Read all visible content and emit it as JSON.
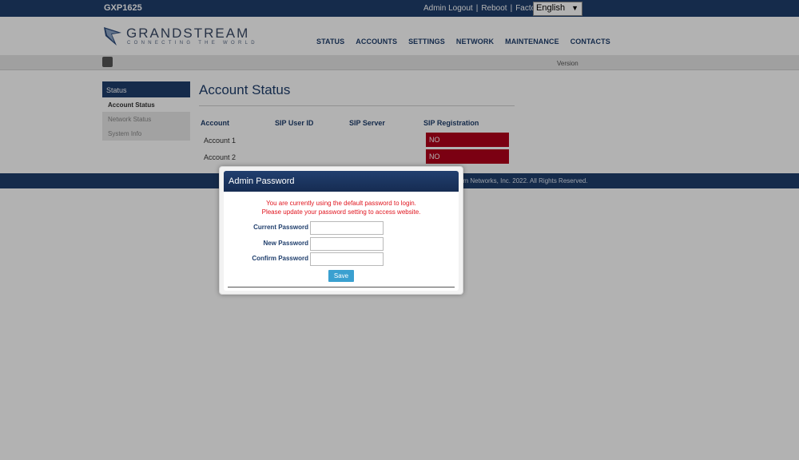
{
  "topbar": {
    "model": "GXP1625",
    "links": [
      "Admin Logout",
      "Reboot",
      "Factory Reset"
    ],
    "separator": "|",
    "language": "English"
  },
  "header": {
    "logo_word": "GRANDSTREAM",
    "logo_tagline": "CONNECTING THE WORLD",
    "nav": [
      "STATUS",
      "ACCOUNTS",
      "SETTINGS",
      "NETWORK",
      "MAINTENANCE",
      "CONTACTS"
    ]
  },
  "subbar": {
    "version_label": "Version"
  },
  "sidebar": {
    "heading": "Status",
    "items": [
      "Account Status",
      "Network Status",
      "System Info"
    ]
  },
  "content": {
    "title": "Account Status",
    "columns": [
      "Account",
      "SIP User ID",
      "SIP Server",
      "SIP Registration"
    ],
    "rows": [
      {
        "account": "Account 1",
        "sip_user_id": "",
        "sip_server": "",
        "registration": "NO"
      },
      {
        "account": "Account 2",
        "sip_user_id": "",
        "sip_server": "",
        "registration": "NO"
      }
    ]
  },
  "footer": {
    "copyright_visible": "am Networks, Inc. 2022. All Rights Reserved."
  },
  "modal": {
    "title": "Admin Password",
    "notice_line1": "You are currently using the default password to login.",
    "notice_line2": "Please update your password setting to access website.",
    "fields": [
      {
        "label": "Current Password",
        "value": ""
      },
      {
        "label": "New Password",
        "value": ""
      },
      {
        "label": "Confirm Password",
        "value": ""
      }
    ],
    "save_label": "Save"
  },
  "colors": {
    "brand_navy": "#1f3e6c",
    "registration_no": "#b0011a",
    "save_button": "#3aa0d0",
    "notice_red": "#e0141e"
  }
}
